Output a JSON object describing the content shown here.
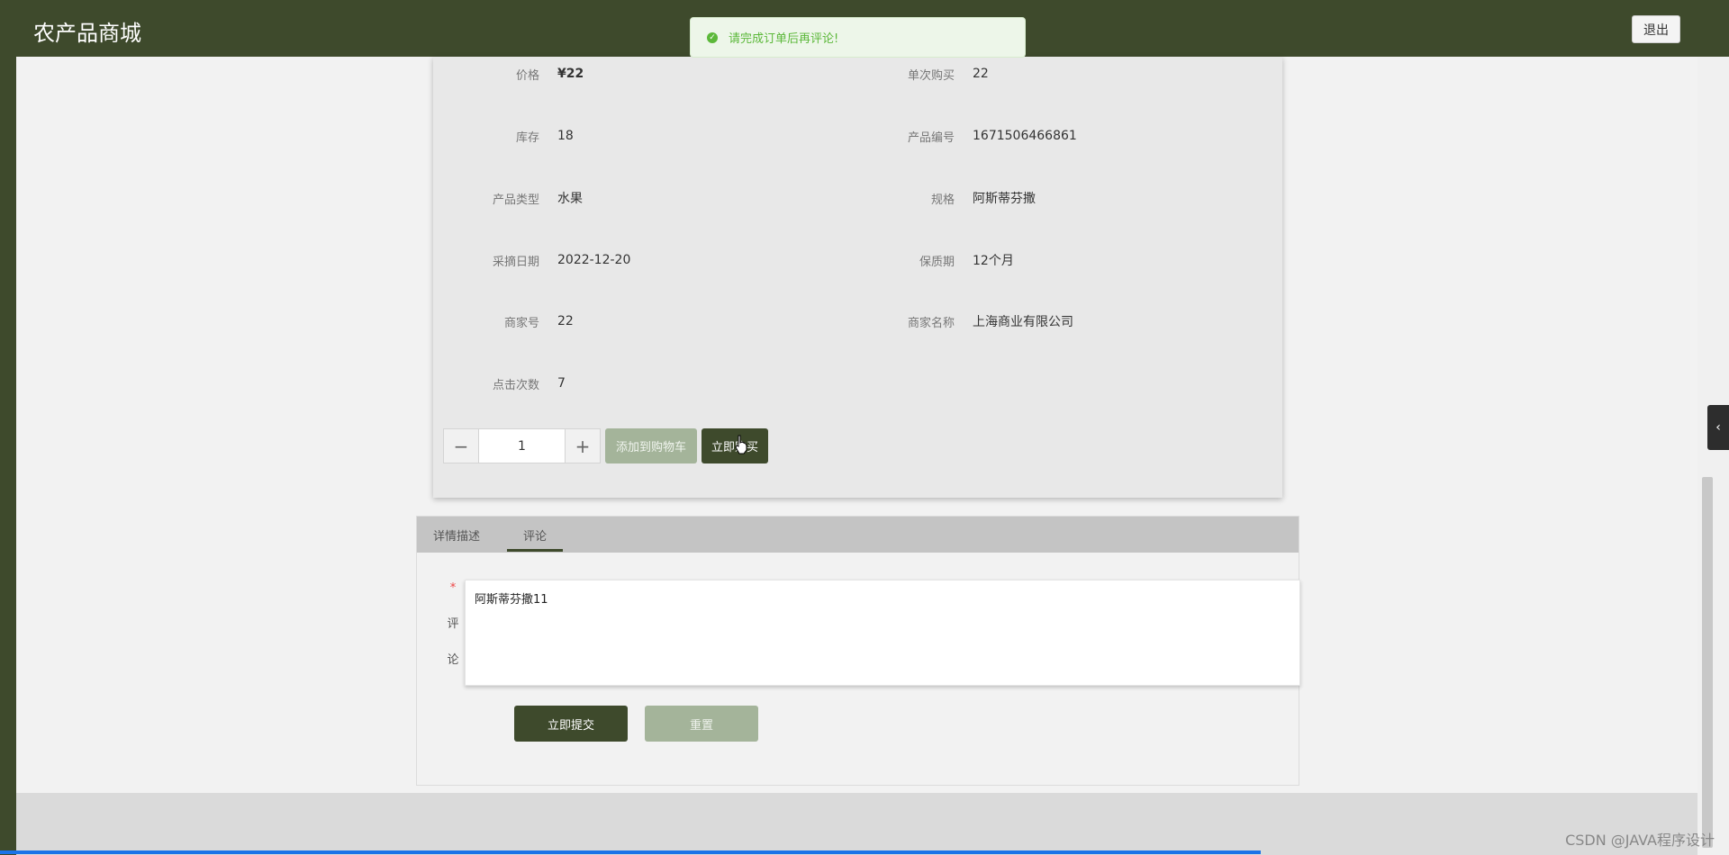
{
  "header": {
    "brand": "农产品商城",
    "logout_label": "退出"
  },
  "toast": {
    "message": "请完成订单后再评论!"
  },
  "product": {
    "fields": [
      {
        "label": "价格",
        "value": "¥22"
      },
      {
        "label": "单次购买",
        "value": "22"
      },
      {
        "label": "库存",
        "value": "18"
      },
      {
        "label": "产品编号",
        "value": "1671506466861"
      },
      {
        "label": "产品类型",
        "value": "水果"
      },
      {
        "label": "规格",
        "value": "阿斯蒂芬撒"
      },
      {
        "label": "采摘日期",
        "value": "2022-12-20"
      },
      {
        "label": "保质期",
        "value": "12个月"
      },
      {
        "label": "商家号",
        "value": "22"
      },
      {
        "label": "商家名称",
        "value": "上海商业有限公司"
      },
      {
        "label": "点击次数",
        "value": "7"
      }
    ],
    "quantity": "1",
    "minus": "−",
    "plus": "+",
    "add_to_cart": "添加到购物车",
    "buy_now": "立即购买"
  },
  "tabs": [
    {
      "label": "详情描述",
      "active": false
    },
    {
      "label": "评论",
      "active": true
    }
  ],
  "comment_form": {
    "required_mark": "*",
    "label_char1": "评",
    "label_char2": "论",
    "value": "阿斯蒂芬撒11",
    "submit_label": "立即提交",
    "reset_label": "重置"
  },
  "side_toggle": "‹",
  "watermark": "CSDN @JAVA程序设计",
  "colors": {
    "primary": "#3e4a2c",
    "muted_button": "#a4b49a",
    "toast_text": "#5cb83a"
  }
}
